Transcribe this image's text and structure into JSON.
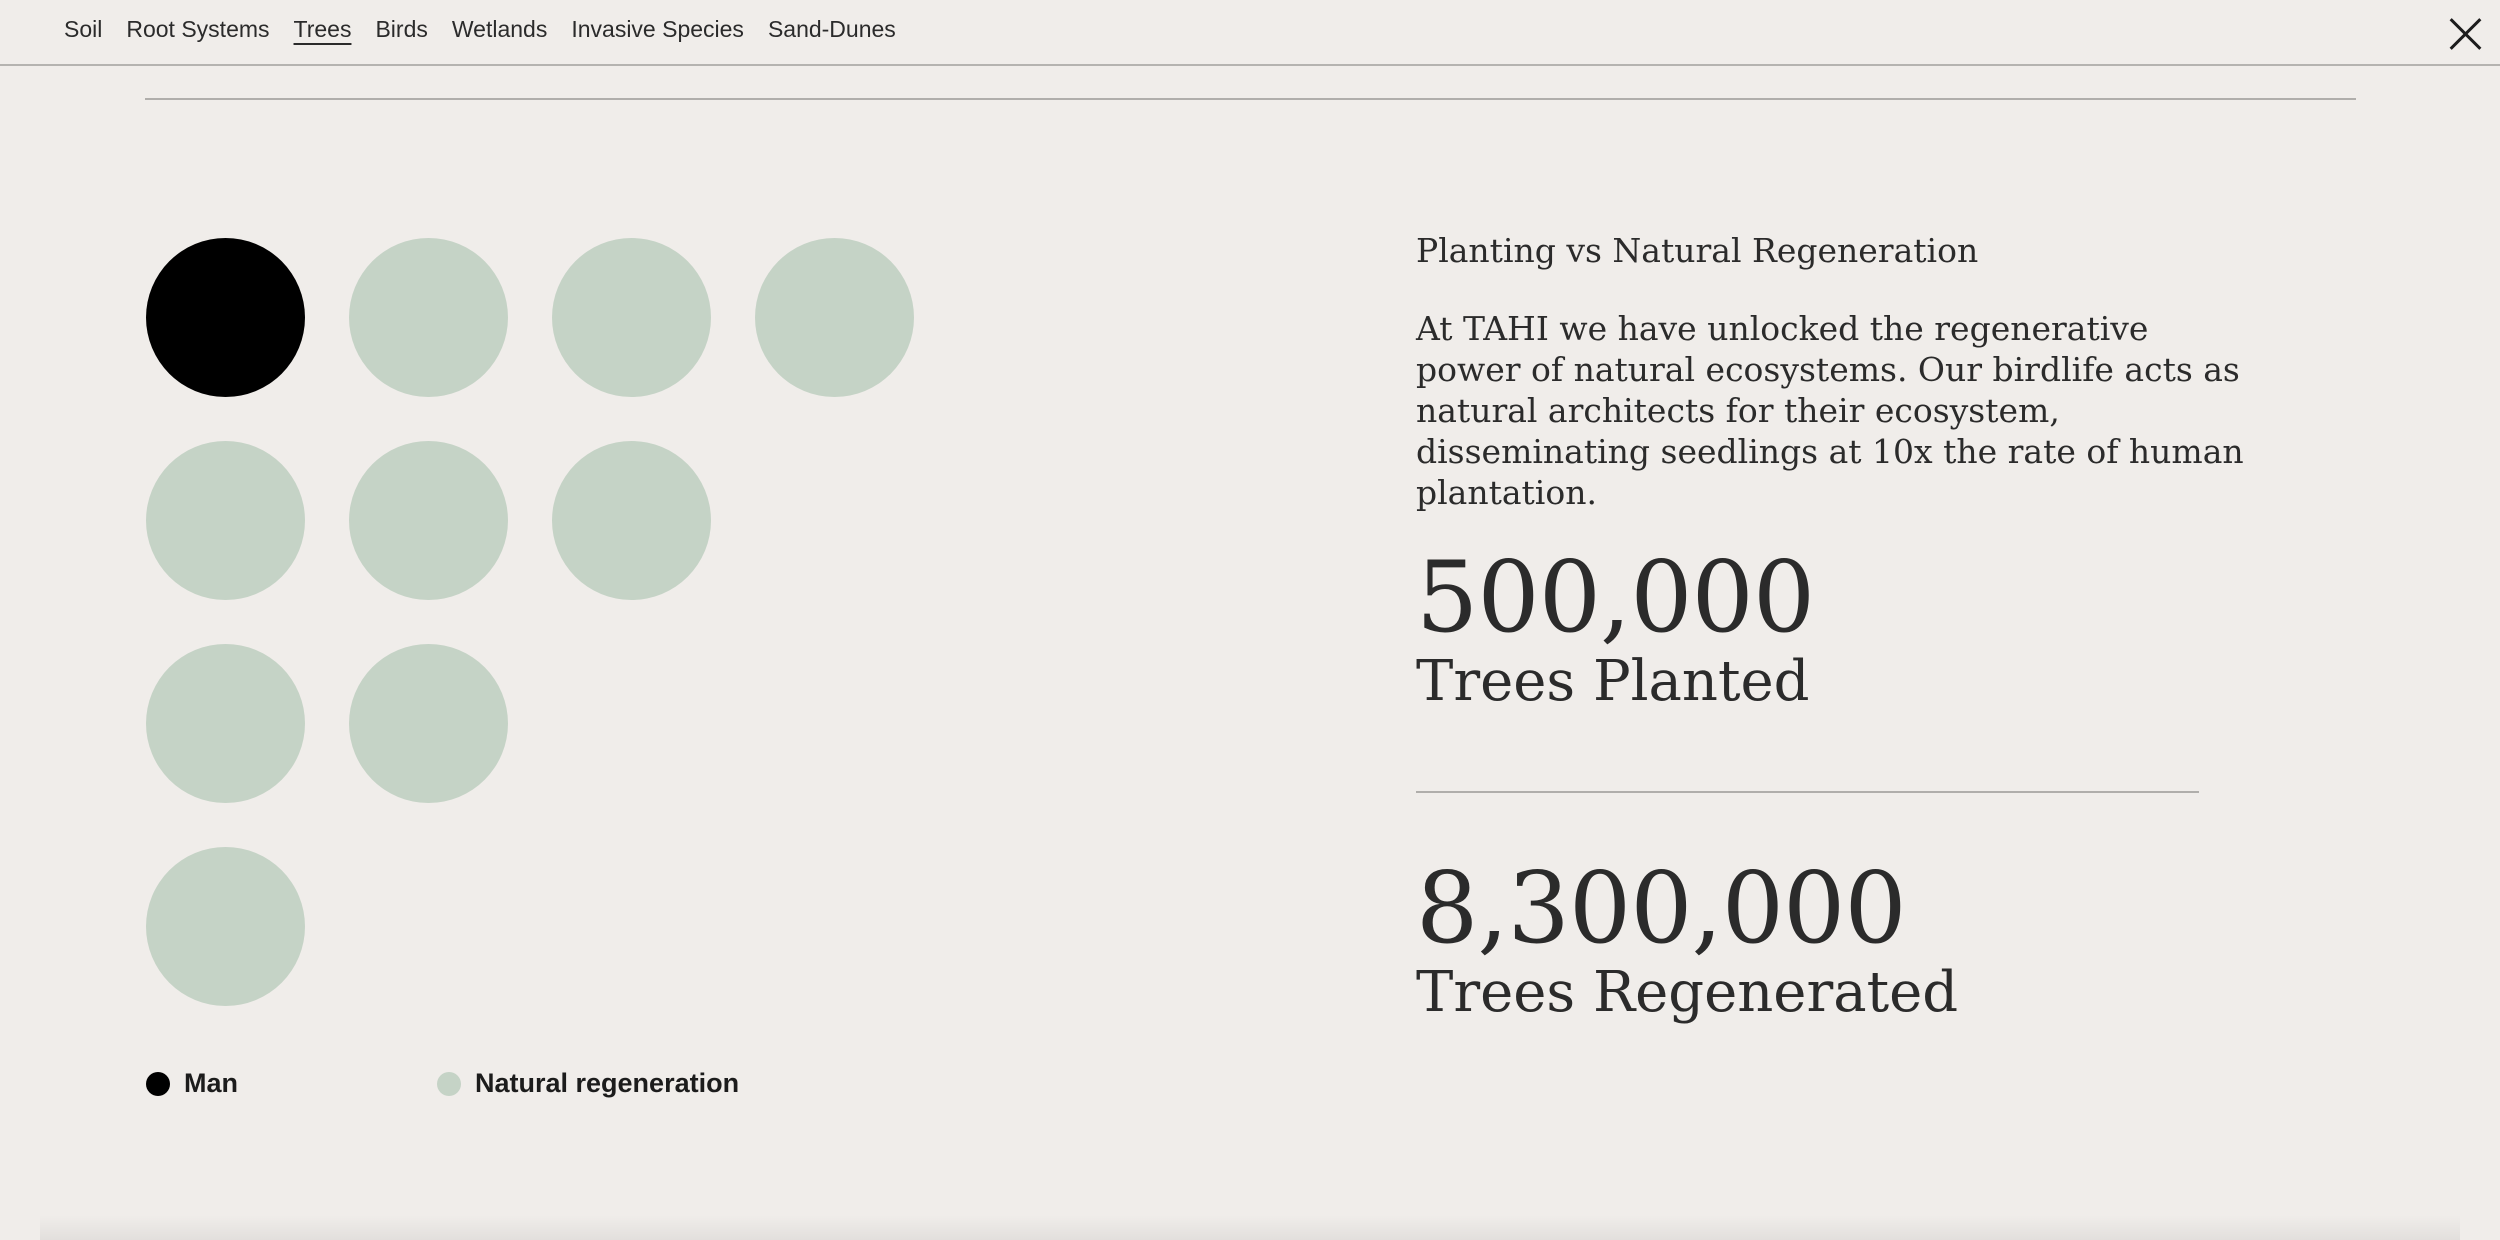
{
  "nav": {
    "items": [
      {
        "label": "Soil",
        "active": false
      },
      {
        "label": "Root Systems",
        "active": false
      },
      {
        "label": "Trees",
        "active": true
      },
      {
        "label": "Birds",
        "active": false
      },
      {
        "label": "Wetlands",
        "active": false
      },
      {
        "label": "Invasive Species",
        "active": false
      },
      {
        "label": "Sand-Dunes",
        "active": false
      }
    ],
    "close_icon": "close-icon"
  },
  "visual": {
    "man_count": 1,
    "natural_count": 9,
    "colors": {
      "man": "#000000",
      "natural": "#c5d3c6",
      "background": "#f0edea",
      "text": "#2b2b2b"
    }
  },
  "legend": {
    "man_label": "Man",
    "natural_label": "Natural regeneration"
  },
  "panel": {
    "title": "Planting vs Natural Regeneration",
    "text": "At TAHI we have unlocked the regenerative power of natural ecosystems. Our birdlife acts as natural architects for their ecosystem, disseminating seedlings at 10x the rate of human plantation.",
    "stat1_value": "500,000",
    "stat1_label": "Trees Planted",
    "stat2_value": "8,300,000",
    "stat2_label": "Trees Regenerated"
  }
}
